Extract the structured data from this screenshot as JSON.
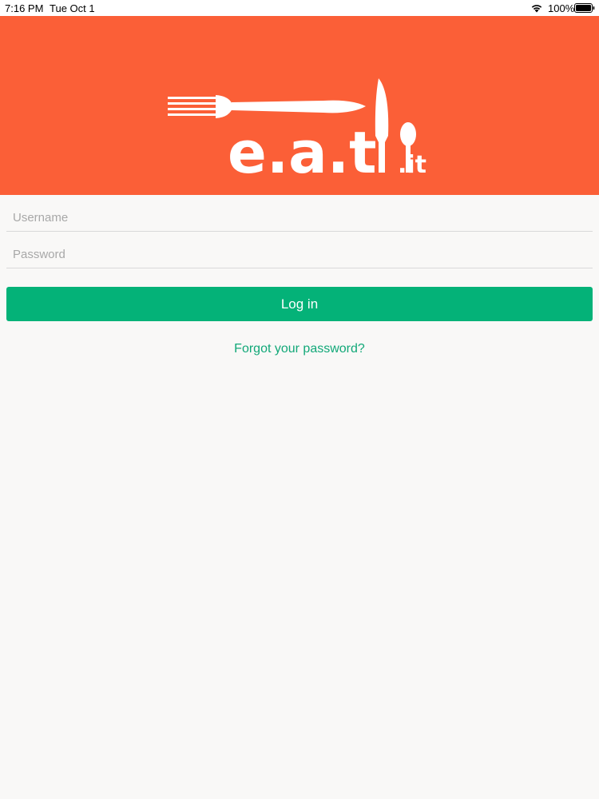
{
  "status_bar": {
    "time": "7:16 PM",
    "date": "Tue Oct 1",
    "battery_percent": "100%",
    "battery_level": 1.0
  },
  "header": {
    "background_color": "#fb5f37",
    "logo_text_main": "e.a.t",
    "logo_text_suffix": ".it"
  },
  "login_form": {
    "username_placeholder": "Username",
    "username_value": "",
    "password_placeholder": "Password",
    "password_value": "",
    "login_label": "Log in",
    "forgot_password_label": "Forgot your password?"
  },
  "colors": {
    "brand_orange": "#fb5f37",
    "button_green": "#04b278",
    "link_green": "#12a878",
    "background": "#f9f8f7"
  }
}
